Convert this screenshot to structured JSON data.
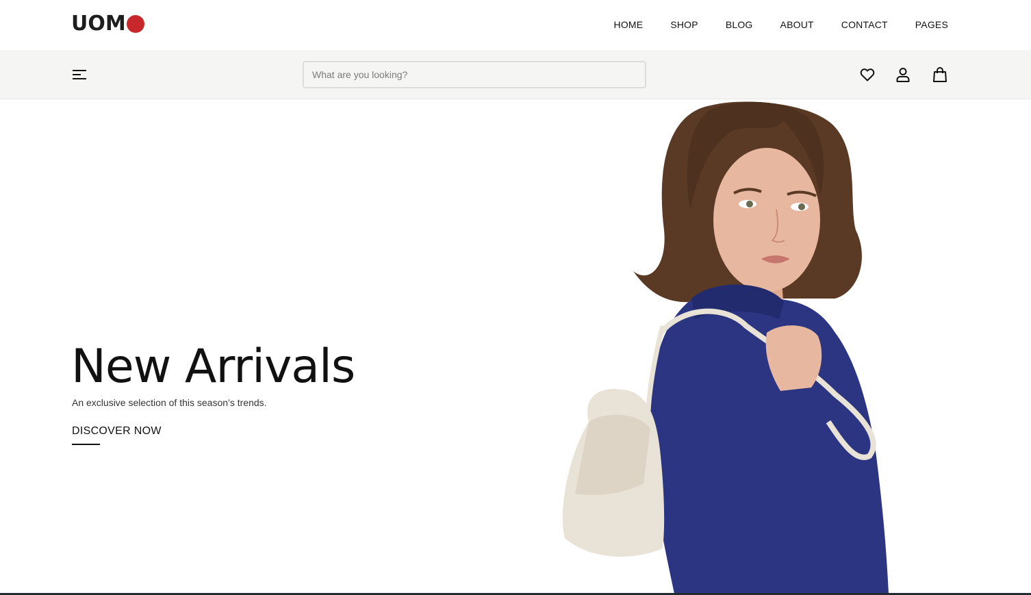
{
  "brand": {
    "logo_text": "UOM",
    "accent_color": "#c8282c"
  },
  "nav": {
    "items": [
      "HOME",
      "SHOP",
      "BLOG",
      "ABOUT",
      "CONTACT",
      "PAGES"
    ]
  },
  "search": {
    "placeholder": "What are you looking?"
  },
  "icons": {
    "menu": "hamburger-menu-icon",
    "wishlist": "heart-icon",
    "account": "user-icon",
    "cart": "shopping-bag-icon"
  },
  "hero": {
    "title": "New Arrivals",
    "subtitle": "An exclusive selection of this season’s trends.",
    "cta_label": "DISCOVER NOW",
    "figure_colors": {
      "blouse": "#2b3582",
      "bag": "#e9e2d6",
      "hair": "#5a3a24",
      "skin": "#e8b79f"
    }
  }
}
